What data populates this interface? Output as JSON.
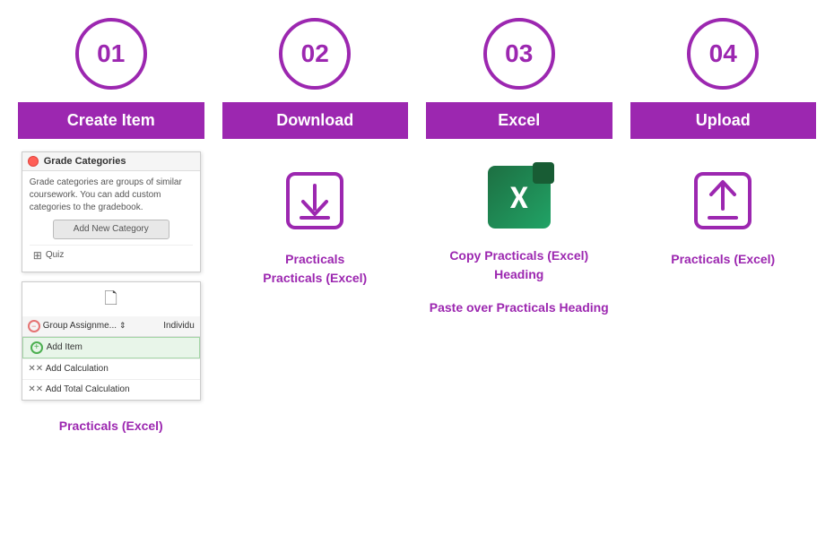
{
  "steps": [
    {
      "number": "01",
      "header": "Create Item",
      "mockup1": {
        "title": "Grade Categories",
        "description": "Grade categories are groups of similar coursework. You can add custom categories to the gradebook.",
        "button": "Add New Category",
        "row": "Quiz"
      },
      "mockup2": {
        "header_left": "Group Assignme...",
        "header_right": "Individu",
        "rows": [
          {
            "label": "Add Item",
            "type": "add"
          },
          {
            "label": "Add Calculation",
            "type": "cross"
          },
          {
            "label": "Add Total Calculation",
            "type": "cross"
          }
        ]
      },
      "bottom_text": "Practicals (Excel)"
    },
    {
      "number": "02",
      "header": "Download",
      "desc": "Practicals\nPracticals (Excel)"
    },
    {
      "number": "03",
      "header": "Excel",
      "desc1": "Copy Practicals (Excel) Heading",
      "desc2": "Paste over Practicals Heading"
    },
    {
      "number": "04",
      "header": "Upload",
      "desc": "Practicals\n(Excel)"
    }
  ],
  "icons": {
    "download": "⬇",
    "upload": "⬆",
    "excel_x": "X",
    "circle_minus": "−",
    "circle_plus": "+",
    "crosshair": "✕",
    "grid": "▦",
    "document": "🗋",
    "close": "×"
  }
}
